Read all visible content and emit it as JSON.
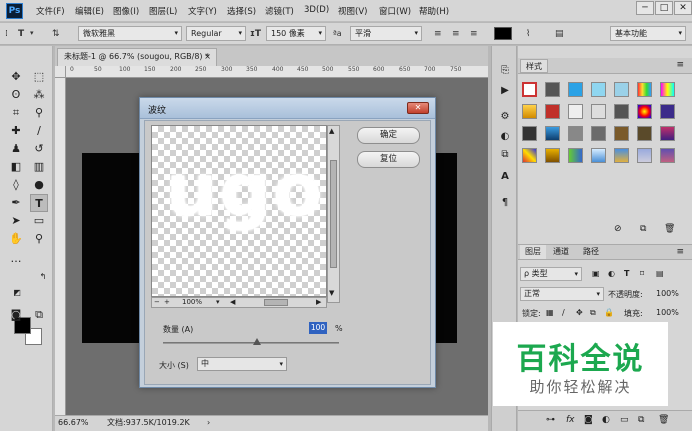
{
  "app": {
    "logo": "Ps"
  },
  "menu": [
    "文件(F)",
    "编辑(E)",
    "图像(I)",
    "图层(L)",
    "文字(Y)",
    "选择(S)",
    "滤镜(T)",
    "3D(D)",
    "视图(V)",
    "窗口(W)",
    "帮助(H)"
  ],
  "window_controls": {
    "minimize": "─",
    "maximize": "□",
    "close": "✕"
  },
  "options": {
    "tool_glyph": "T",
    "font_family": "微软雅黑",
    "font_style": "Regular",
    "font_size": "150 像素",
    "aa_label": "ªa",
    "antialias": "平滑",
    "workspace": "基本功能"
  },
  "document": {
    "tab_title": "未标题-1 @ 66.7% (sougou, RGB/8) *",
    "tab_close": "×",
    "ruler_ticks": [
      "0",
      "50",
      "100",
      "150",
      "200",
      "250",
      "300",
      "350",
      "400",
      "450",
      "500",
      "550",
      "600",
      "650",
      "700",
      "750"
    ],
    "zoom": "66.67%",
    "doc_info": "文档:937.5K/1019.2K"
  },
  "dialog": {
    "title": "波纹",
    "close": "✕",
    "preview_text": "ugo",
    "preview_zoom": "100%",
    "zoom_minus": "−",
    "zoom_plus": "+",
    "ok_label": "确定",
    "reset_label": "复位",
    "amount_label": "数量 (A)",
    "amount_value": "100",
    "amount_unit": "%",
    "size_label": "大小 (S)",
    "size_value": "中"
  },
  "panels": {
    "styles_tab": "样式",
    "layers_tabs": [
      "图层",
      "通道",
      "路径"
    ],
    "filter_kind": "ρ 类型",
    "blend_mode": "正常",
    "opacity_label": "不透明度:",
    "opacity_value": "100%",
    "lock_label": "锁定:",
    "fill_label": "填充:",
    "fill_value": "100%"
  },
  "watermark": {
    "main": "百科全说",
    "sub": "助你轻松解决"
  },
  "colors": {
    "fg": "#000000",
    "bg": "#ffffff",
    "accent": "#1ca84f"
  },
  "icons": [
    "move-icon",
    "marquee-icon",
    "lasso-icon",
    "magic-wand-icon",
    "crop-icon",
    "eyedropper-icon",
    "healing-icon",
    "brush-icon",
    "stamp-icon",
    "history-brush-icon",
    "eraser-icon",
    "gradient-icon",
    "blur-icon",
    "dodge-icon",
    "pen-icon",
    "type-icon",
    "path-select-icon",
    "shape-icon",
    "hand-icon",
    "zoom-icon"
  ]
}
